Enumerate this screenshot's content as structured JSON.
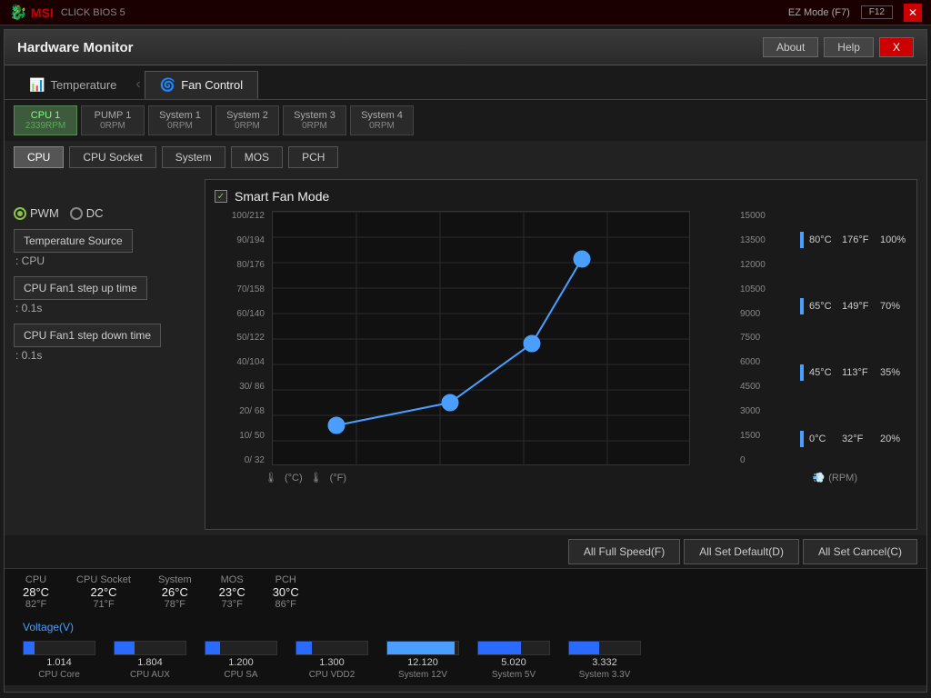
{
  "topbar": {
    "logo": "MSI",
    "ez_mode": "EZ Mode (F7)",
    "f12_label": "F12",
    "close_label": "✕"
  },
  "window": {
    "title": "Hardware Monitor",
    "buttons": {
      "about": "About",
      "help": "Help",
      "close": "X"
    }
  },
  "tabs": {
    "temperature": {
      "label": "Temperature",
      "active": false,
      "icon": "📊"
    },
    "fan_control": {
      "label": "Fan Control",
      "active": true,
      "icon": "🌀"
    }
  },
  "fan_tabs": [
    {
      "id": "cpu1",
      "label": "CPU 1",
      "rpm": "2339RPM",
      "active": true
    },
    {
      "id": "pump1",
      "label": "PUMP 1",
      "rpm": "0RPM",
      "active": false
    },
    {
      "id": "sys1",
      "label": "System 1",
      "rpm": "0RPM",
      "active": false
    },
    {
      "id": "sys2",
      "label": "System 2",
      "rpm": "0RPM",
      "active": false
    },
    {
      "id": "sys3",
      "label": "System 3",
      "rpm": "0RPM",
      "active": false
    },
    {
      "id": "sys4",
      "label": "System 4",
      "rpm": "0RPM",
      "active": false
    }
  ],
  "sensor_buttons": [
    {
      "id": "cpu",
      "label": "CPU",
      "active": true
    },
    {
      "id": "cpu_socket",
      "label": "CPU Socket",
      "active": false
    },
    {
      "id": "system",
      "label": "System",
      "active": false
    },
    {
      "id": "mos",
      "label": "MOS",
      "active": false
    },
    {
      "id": "pch",
      "label": "PCH",
      "active": false
    }
  ],
  "controls": {
    "pwm_label": "PWM",
    "dc_label": "DC",
    "temp_source_btn": "Temperature Source",
    "temp_source_value": ": CPU",
    "step_up_btn": "CPU Fan1 step up time",
    "step_up_value": ": 0.1s",
    "step_down_btn": "CPU Fan1 step down time",
    "step_down_value": ": 0.1s"
  },
  "chart": {
    "title": "Smart Fan Mode",
    "y_labels_left": [
      "100/212",
      "90/194",
      "80/176",
      "70/158",
      "60/140",
      "50/122",
      "40/104",
      "30/ 86",
      "20/ 68",
      "10/ 50",
      "0/ 32"
    ],
    "y_labels_right": [
      "15000",
      "13500",
      "12000",
      "10500",
      "9000",
      "7500",
      "6000",
      "4500",
      "3000",
      "1500",
      "0"
    ],
    "temp_points": [
      {
        "temp_c": "80°C",
        "temp_f": "176°F",
        "pct": "100%"
      },
      {
        "temp_c": "65°C",
        "temp_f": "149°F",
        "pct": "70%"
      },
      {
        "temp_c": "45°C",
        "temp_f": "113°F",
        "pct": "35%"
      },
      {
        "temp_c": "0°C",
        "temp_f": "32°F",
        "pct": "20%"
      }
    ],
    "footer_left_celsius": "℃",
    "footer_left_label": "(°C)",
    "footer_left_f": "(°F)",
    "footer_right_icon": "fan",
    "footer_right_label": "(RPM)"
  },
  "bottom_buttons": {
    "full_speed": "All Full Speed(F)",
    "set_default": "All Set Default(D)",
    "cancel": "All Set Cancel(C)"
  },
  "temp_readings": [
    {
      "label": "CPU",
      "celsius": "28°C",
      "fahrenheit": "82°F"
    },
    {
      "label": "CPU Socket",
      "celsius": "22°C",
      "fahrenheit": "71°F"
    },
    {
      "label": "System",
      "celsius": "26°C",
      "fahrenheit": "78°F"
    },
    {
      "label": "MOS",
      "celsius": "23°C",
      "fahrenheit": "73°F"
    },
    {
      "label": "PCH",
      "celsius": "30°C",
      "fahrenheit": "86°F"
    }
  ],
  "voltage": {
    "title": "Voltage(V)",
    "items": [
      {
        "label": "CPU Core",
        "value": "1.014",
        "fill_pct": 15,
        "highlight": false
      },
      {
        "label": "CPU AUX",
        "value": "1.804",
        "fill_pct": 28,
        "highlight": false
      },
      {
        "label": "CPU SA",
        "value": "1.200",
        "fill_pct": 20,
        "highlight": false
      },
      {
        "label": "CPU VDD2",
        "value": "1.300",
        "fill_pct": 22,
        "highlight": false
      },
      {
        "label": "System 12V",
        "value": "12.120",
        "fill_pct": 95,
        "highlight": true
      },
      {
        "label": "System 5V",
        "value": "5.020",
        "fill_pct": 60,
        "highlight": false
      },
      {
        "label": "System 3.3V",
        "value": "3.332",
        "fill_pct": 42,
        "highlight": false
      }
    ]
  }
}
